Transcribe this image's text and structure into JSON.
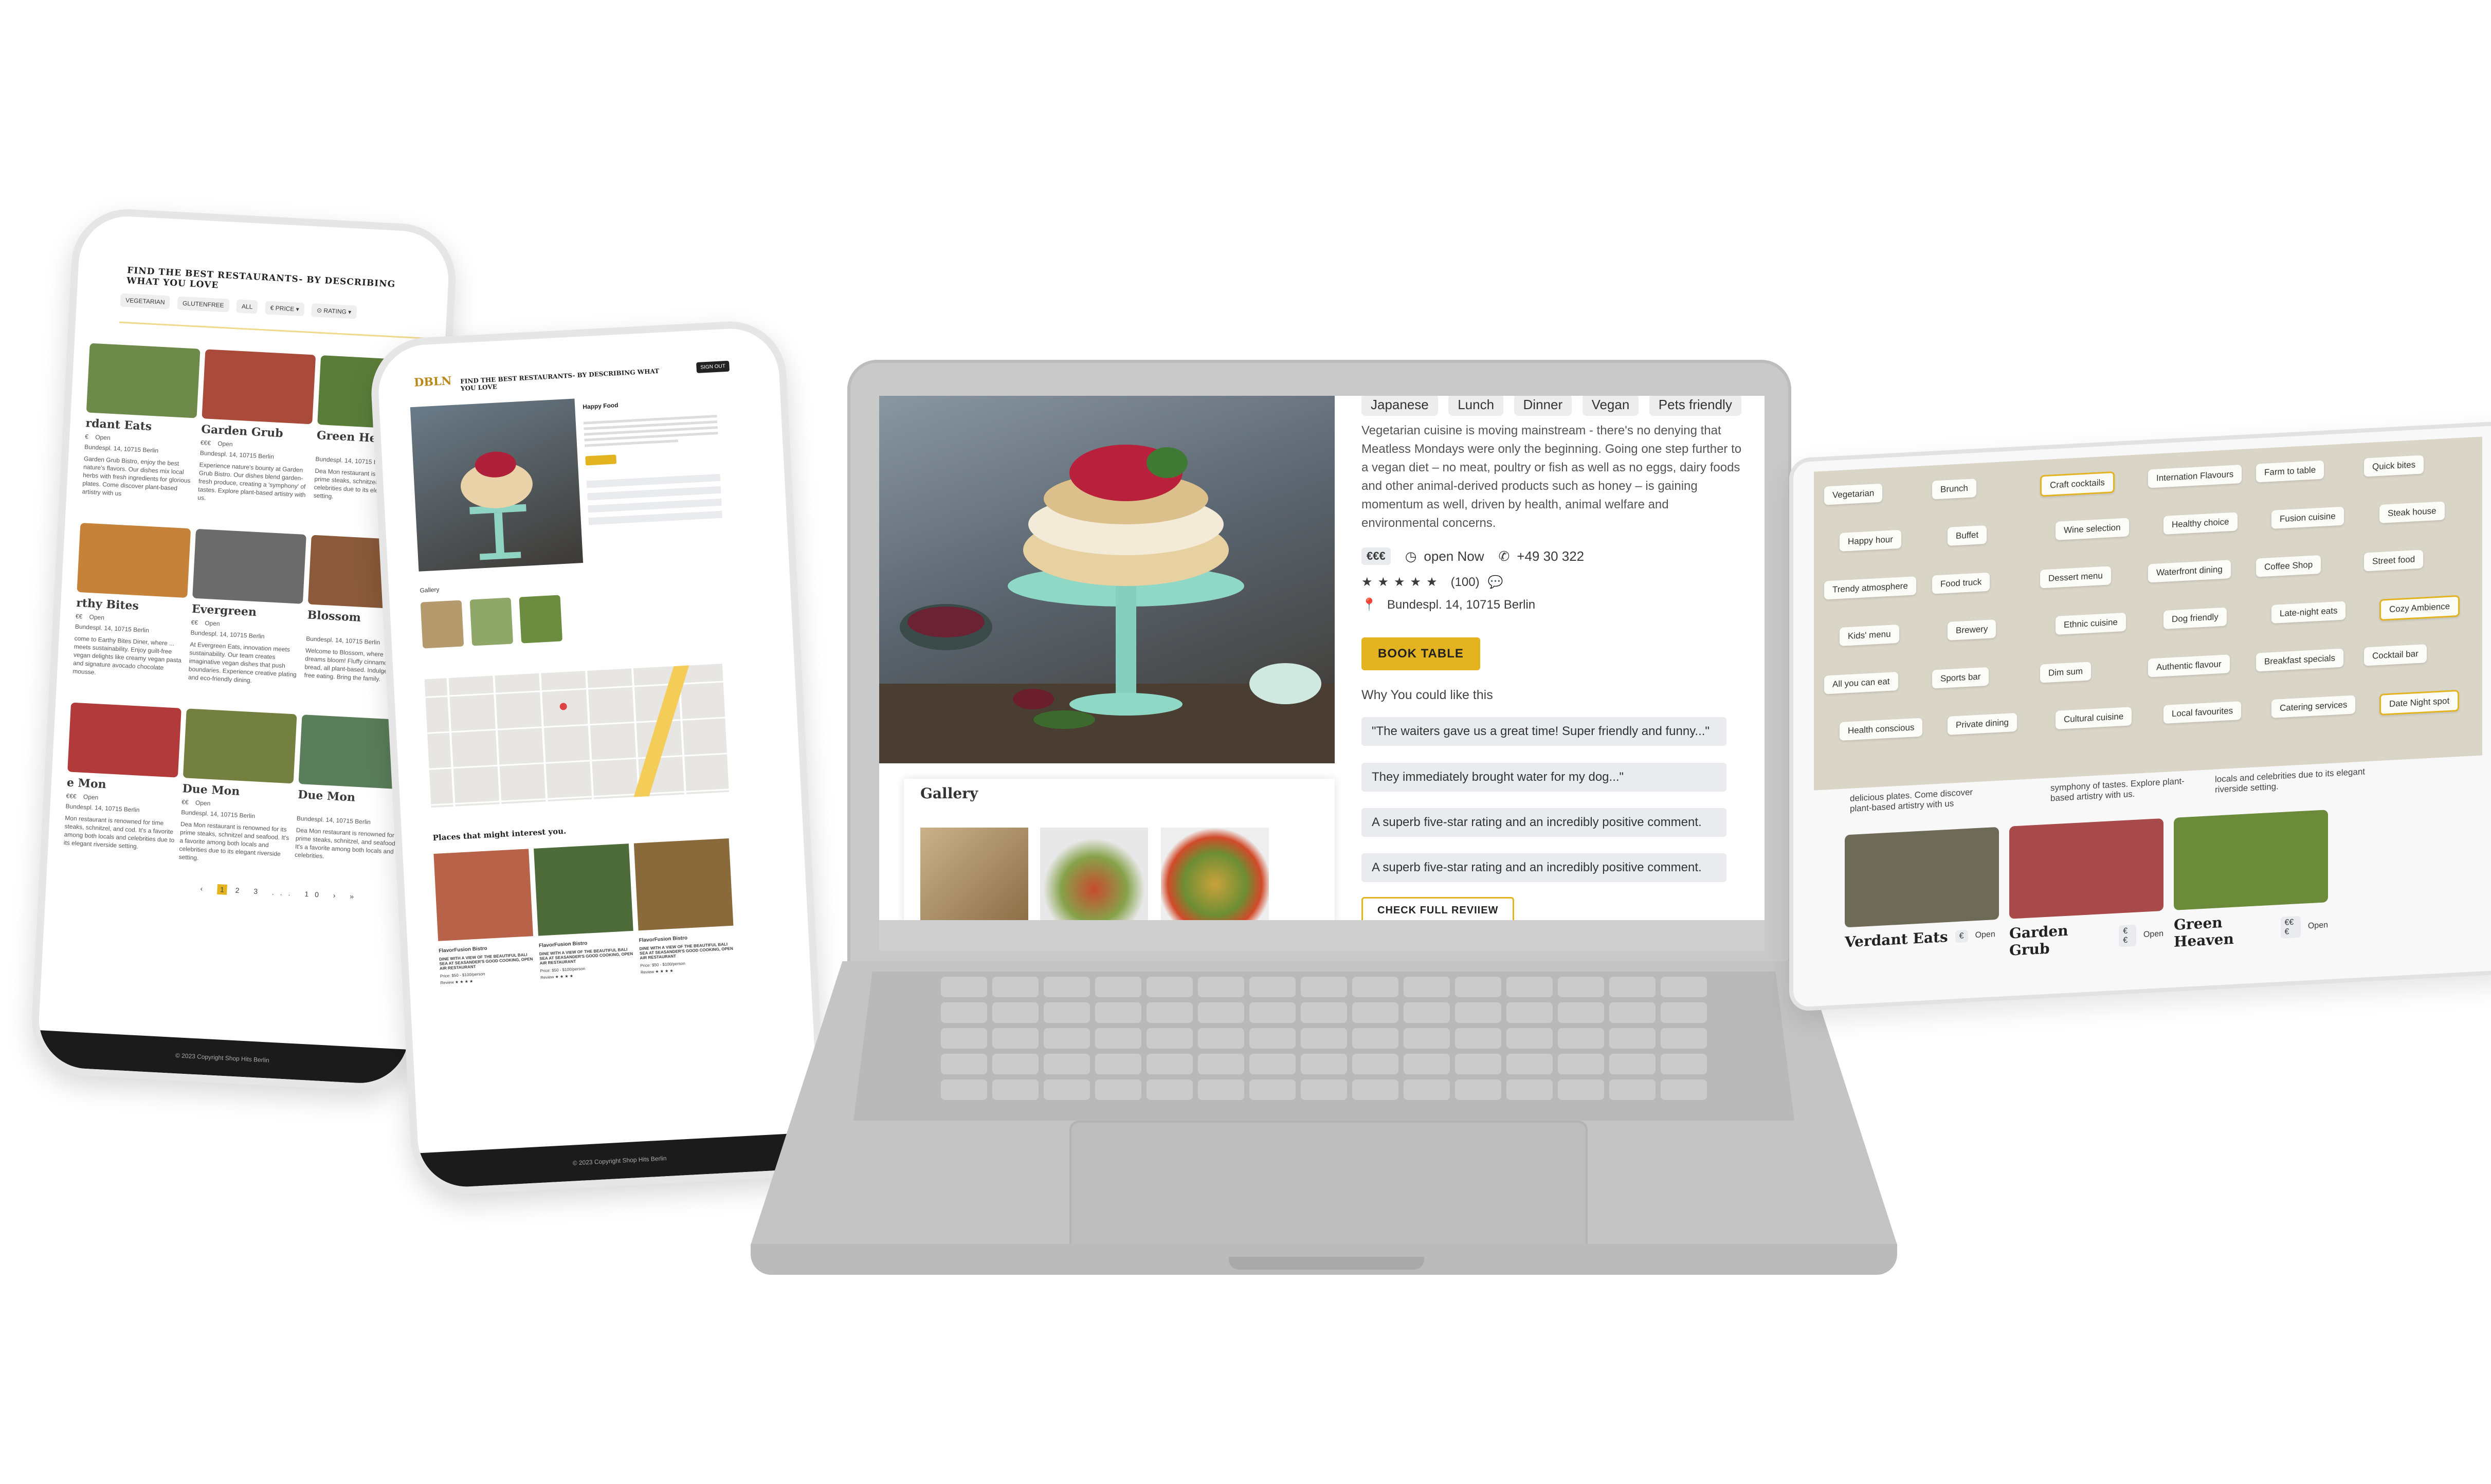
{
  "laptop": {
    "tags": [
      "Japanese",
      "Lunch",
      "Dinner",
      "Vegan",
      "Pets friendly"
    ],
    "description": "Vegetarian cuisine is moving mainstream - there's no denying that Meatless Mondays were only the beginning. Going one step further to a vegan diet – no meat, poultry or fish as well as no eggs, dairy foods and other animal-derived products such as honey – is gaining momentum as well, driven by health, animal welfare and environmental concerns.",
    "price": "€€€",
    "status": "open Now",
    "phone": "+49 30 322",
    "rating_count": "(100)",
    "address": "Bundespl. 14, 10715 Berlin",
    "book_label": "BOOK TABLE",
    "why_title": "Why You could like this",
    "quotes": [
      "\"The waiters gave us a great time! Super friendly and funny...\"",
      "They immediately brought water for my dog...\"",
      "A superb five-star rating and an incredibly positive comment.",
      "A superb five-star rating and an incredibly positive comment."
    ],
    "review_label": "CHECK FULL REVIIEW",
    "gallery_title": "Gallery"
  },
  "phone1": {
    "headline": "FIND THE BEST RESTAURANTS- BY DESCRIBING WHAT YOU LOVE",
    "filters": [
      "VEGETARIAN",
      "GLUTENFREE",
      "ALL",
      "€ PRICE ▾",
      "⊙ RATING ▾"
    ],
    "cards": [
      {
        "name": "rdant Eats",
        "price": "€",
        "status": "Open",
        "desc": "Garden Grub Bistro, enjoy the best nature's flavors. Our dishes mix local herbs with fresh ingredients for glorious plates. Come discover plant-based artistry with us"
      },
      {
        "name": "Garden Grub",
        "price": "€€€",
        "status": "Open",
        "desc": "Experience nature's bounty at Garden Grub Bistro. Our dishes blend garden-fresh produce, creating a 'symphony' of tastes. Explore plant-based artistry with us."
      },
      {
        "name": "Green Heaven",
        "price": "",
        "status": "",
        "desc": "Dea Mon restaurant is renowned for its prime steaks, schnitzel and locals and celebrities due to its elegant riverside setting."
      },
      {
        "name": "rthy Bites",
        "price": "€€",
        "status": "Open",
        "desc": "come to Earthy Bites Diner, where ... meets sustainability. Enjoy guilt-free vegan delights like creamy vegan pasta and signature avocado chocolate mousse."
      },
      {
        "name": "Evergreen",
        "price": "€€",
        "status": "Open",
        "desc": "At Evergreen Eats, innovation meets sustainability. Our team creates imaginative vegan dishes that push boundaries. Experience creative plating and eco-friendly dining."
      },
      {
        "name": "Blossom",
        "price": "",
        "status": "",
        "desc": "Welcome to Blossom, where vegan dreams bloom! Fluffy cinnamon rolls, bread, all plant-based. Indulge in guilt-free eating. Bring the family."
      },
      {
        "name": "e Mon",
        "price": "€€€",
        "status": "Open",
        "desc": "Mon restaurant is renowned for time steaks, schnitzel, and cod. It's a favorite among both locals and celebrities due to its elegant riverside setting."
      },
      {
        "name": "Due Mon",
        "price": "€€",
        "status": "Open",
        "desc": "Dea Mon restaurant is renowned for its prime steaks, schnitzel and seafood. It's a favorite among both locals and celebrities due to its elegant riverside setting."
      },
      {
        "name": "Due Mon",
        "price": "",
        "status": "",
        "desc": "Dea Mon restaurant is renowned for its prime steaks, schnitzel, and seafood. It's a favorite among both locals and celebrities."
      }
    ],
    "address": "Bundespl. 14, 10715 Berlin",
    "pagination": [
      "‹",
      "1",
      "2",
      "3",
      "...",
      "10",
      "›",
      "»"
    ],
    "footer": "© 2023 Copyright Shop Hits Berlin"
  },
  "phone2": {
    "logo": "DBLN",
    "headline": "FIND THE BEST RESTAURANTS- BY DESCRIBING WHAT YOU LOVE",
    "login": "SIGN OUT",
    "title": "Happy Food",
    "gallery_title": "Gallery",
    "places_title": "Places that might interest you.",
    "place_cards": [
      {
        "name": "FlavorFusion Bistro",
        "desc": "DINE WITH A VIEW OF THE BEAUTIFUL BALI SEA AT SEASANDER'S GOOD COOKING, OPEN AIR RESTAURANT",
        "price": "Price: $50 - $100/person",
        "review": "Review"
      },
      {
        "name": "FlavorFusion Bistro",
        "desc": "DINE WITH A VIEW OF THE BEAUTIFUL BALI SEA AT SEASANDER'S GOOD COOKING, OPEN AIR RESTAURANT",
        "price": "Price: $50 - $100/person",
        "review": "Review"
      },
      {
        "name": "FlavorFusion Bistro",
        "desc": "DINE WITH A VIEW OF THE BEAUTIFUL BALI SEA AT SEASANDER'S GOOD COOKING, OPEN AIR RESTAURANT",
        "price": "Price: $50 - $100/person",
        "review": "Review"
      }
    ],
    "footer": "© 2023 Copyright Shop Hits Berlin"
  },
  "tablet": {
    "filters": [
      "Vegetarian",
      "Brunch",
      "Craft cocktails",
      "Internation Flavours",
      "Farm to table",
      "Quick bites",
      "Happy hour",
      "Buffet",
      "Wine selection",
      "Healthy choice",
      "Fusion cuisine",
      "Steak house",
      "Trendy atmosphere",
      "Food truck",
      "Dessert menu",
      "Waterfront dining",
      "Coffee Shop",
      "Street food",
      "Kids' menu",
      "Brewery",
      "Ethnic cuisine",
      "Dog friendly",
      "Late-night eats",
      "Cozy Ambience",
      "All you can eat",
      "Sports bar",
      "Dim sum",
      "Authentic flavour",
      "Breakfast specials",
      "Cocktail bar",
      "Health conscious",
      "Private dining",
      "Cultural cuisine",
      "Local favourites",
      "Catering services",
      "Date Night spot"
    ],
    "selected": [
      "Craft cocktails",
      "Cozy Ambience",
      "Date Night spot"
    ],
    "snippets": [
      "delicious plates. Come discover plant-based artistry with us",
      "symphony of tastes. Explore plant-based artistry with us.",
      "locals and celebrities due to its elegant riverside setting."
    ],
    "cards": [
      {
        "name": "Verdant Eats",
        "price": "€",
        "status": "Open"
      },
      {
        "name": "Garden Grub",
        "price": "€€",
        "status": "Open"
      },
      {
        "name": "Green Heaven",
        "price": "€€€",
        "status": "Open"
      }
    ]
  },
  "colors": {
    "accent": "#e3b420",
    "chip": "#e9ebee",
    "panel": "#d9d6c8",
    "footer": "#1b1b1b"
  }
}
